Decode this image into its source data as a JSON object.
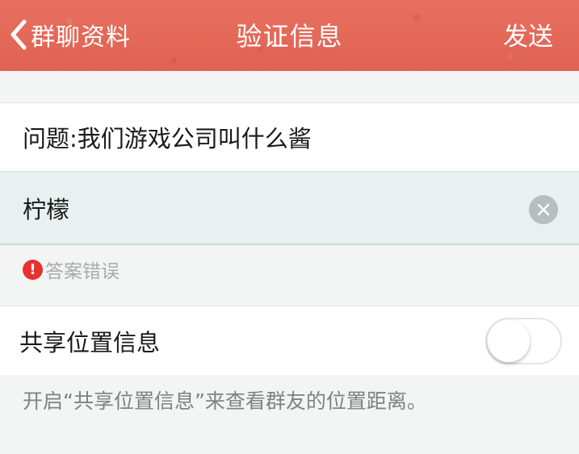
{
  "navbar": {
    "back_label": "群聊资料",
    "title": "验证信息",
    "action_label": "发送",
    "bg_color": "#e4695a"
  },
  "question": {
    "text": "问题:我们游戏公司叫什么酱"
  },
  "answer": {
    "value": "柠檬",
    "clear_icon": "clear-icon"
  },
  "error": {
    "icon": "exclamation-icon",
    "text": "答案错误",
    "color": "#e6322f"
  },
  "share_location": {
    "label": "共享位置信息",
    "enabled": false
  },
  "hint": {
    "text": "开启“共享位置信息”来查看群友的位置距离。"
  }
}
